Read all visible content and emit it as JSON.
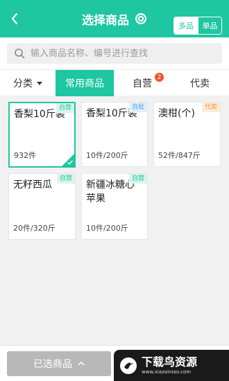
{
  "header": {
    "title": "选择商品",
    "back_icon": "chevron-left-icon",
    "settings_icon": "gear-icon",
    "mode_multi": "多品",
    "mode_single": "单品",
    "accent_color": "#1ec6a1"
  },
  "search": {
    "placeholder": "输入商品名称、编号进行查找",
    "value": ""
  },
  "tabs": {
    "category": "分类",
    "common": "常用商品",
    "self": "自营",
    "self_badge": "2",
    "agent": "代卖"
  },
  "products": [
    {
      "name": "香梨10斤装",
      "tag": "自营",
      "qty": "932件",
      "selected": true
    },
    {
      "name": "香梨10斤装",
      "tag": "自批",
      "qty": "10件/200斤",
      "selected": false
    },
    {
      "name": "澳柑(个)",
      "tag": "代卖",
      "qty": "52件/847斤",
      "selected": false
    },
    {
      "name": "无籽西瓜",
      "tag": "自营",
      "qty": "20件/320斤",
      "selected": false
    },
    {
      "name": "新疆冰糖心苹果",
      "tag": "自营",
      "qty": "10件/200斤",
      "selected": false
    }
  ],
  "bottom": {
    "selected_label": "已选商品"
  },
  "watermark": {
    "title": "下载鸟资源",
    "url": "www.xiazainiao.com"
  }
}
